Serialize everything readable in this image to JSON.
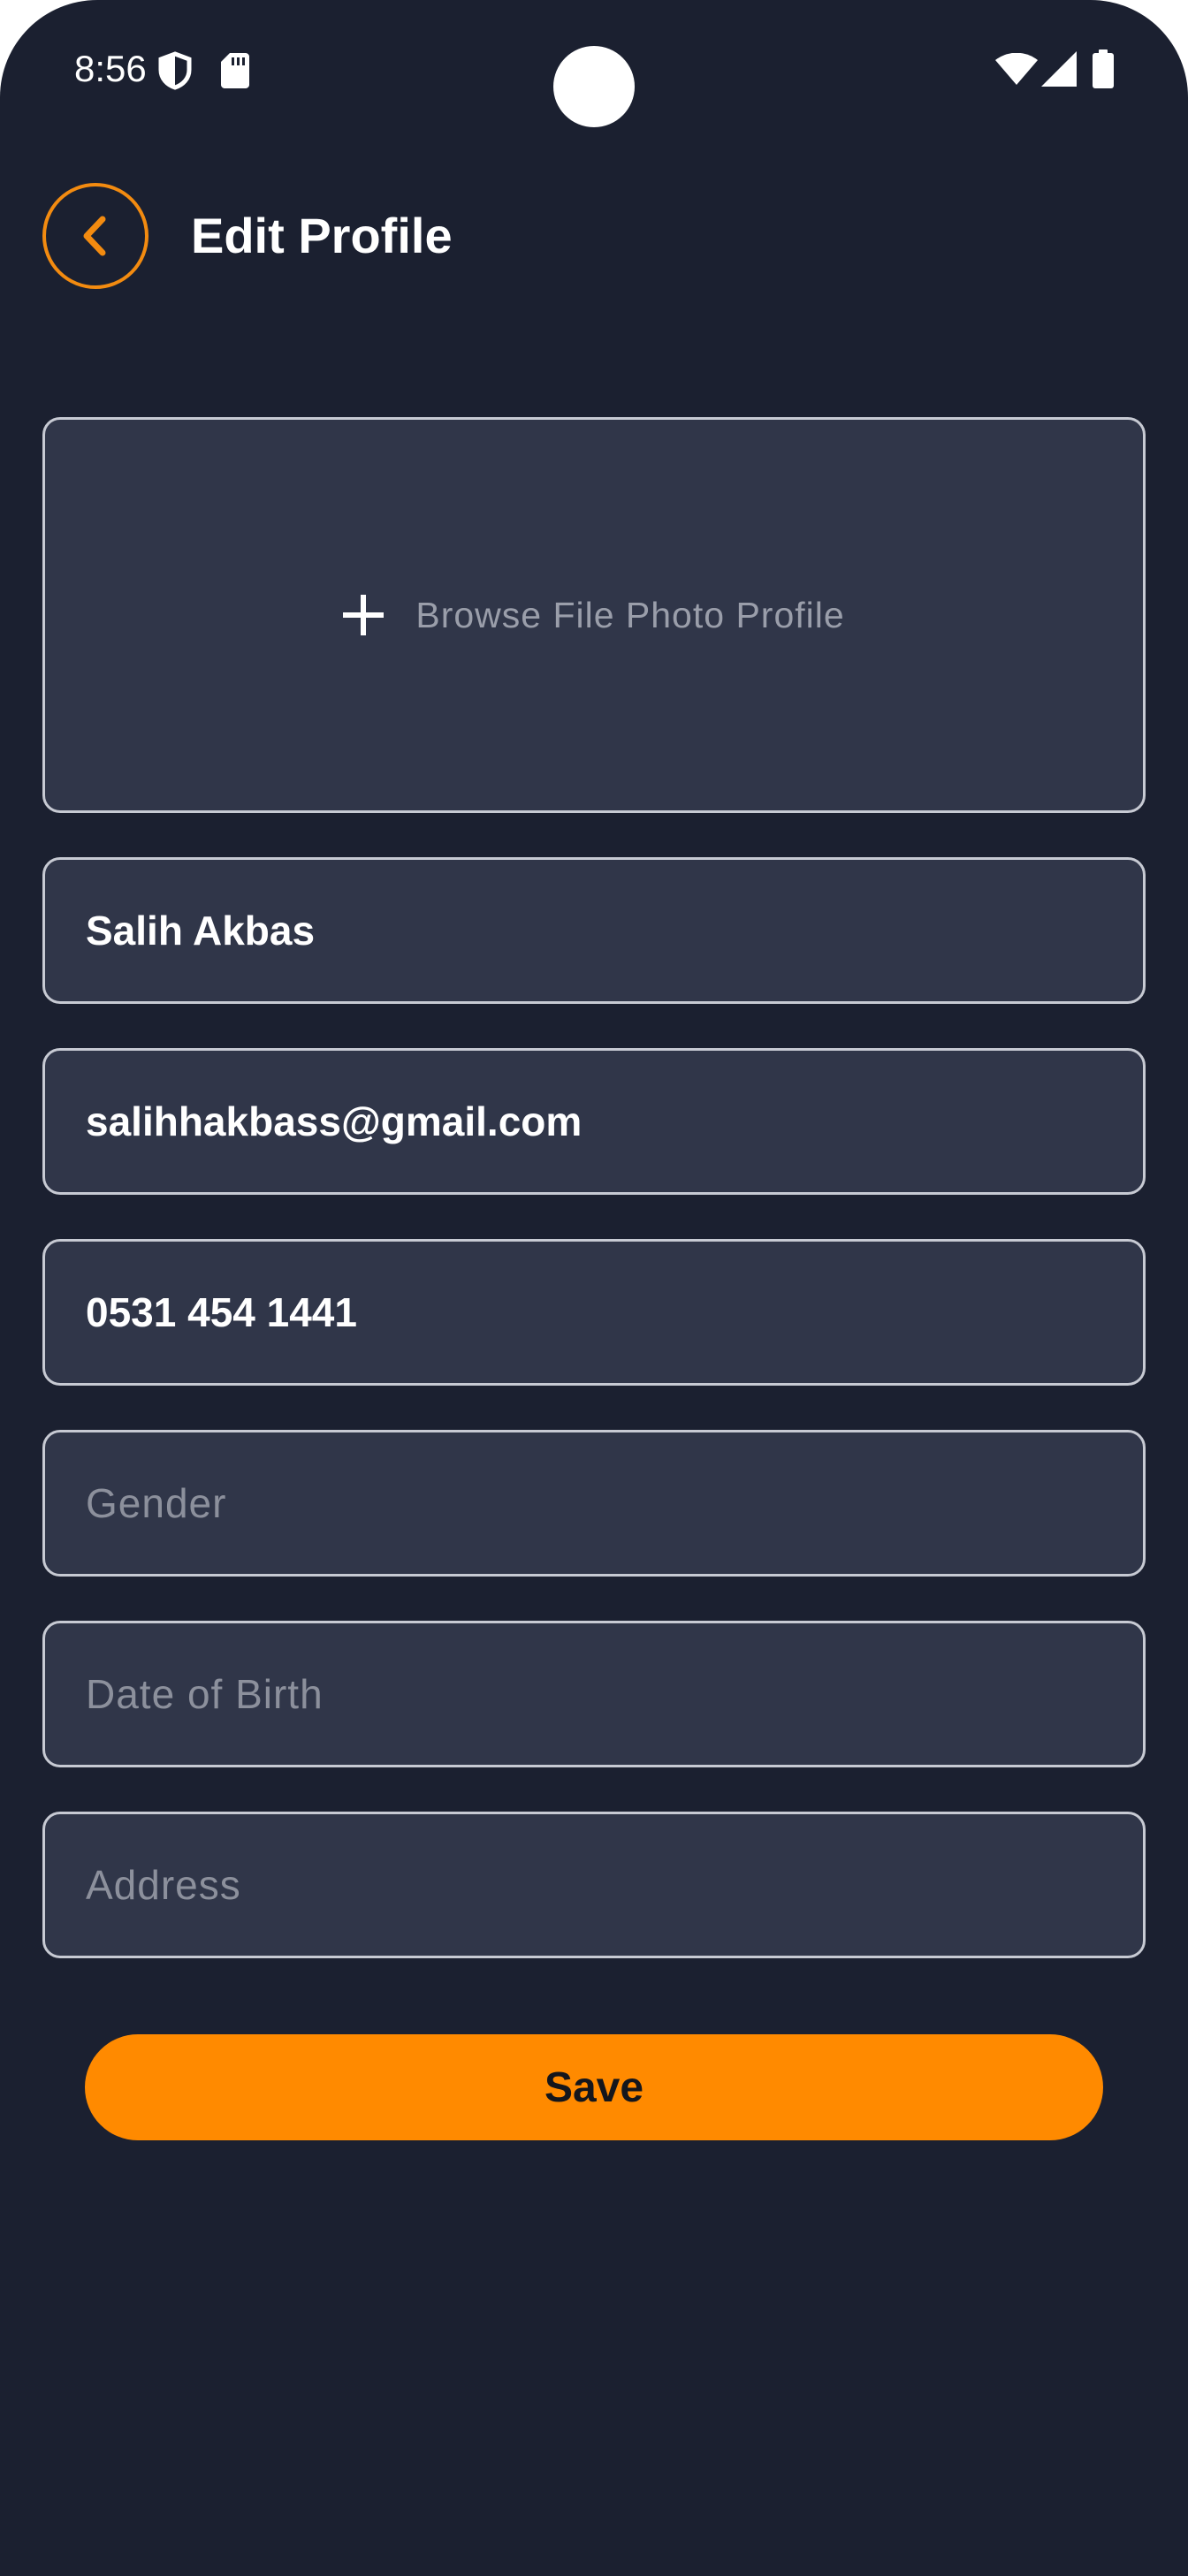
{
  "status_bar": {
    "time": "8:56",
    "icons": [
      "shield-icon",
      "sd-card-icon",
      "wifi-icon",
      "signal-icon",
      "battery-icon"
    ]
  },
  "header": {
    "back_icon": "chevron-left-icon",
    "title": "Edit Profile"
  },
  "photo_upload": {
    "icon": "plus-icon",
    "label": "Browse File Photo Profile"
  },
  "form": {
    "name": {
      "value": "Salih Akbas",
      "placeholder": ""
    },
    "email": {
      "value": "salihhakbass@gmail.com",
      "placeholder": ""
    },
    "phone": {
      "value": "0531 454 1441",
      "placeholder": ""
    },
    "gender": {
      "value": "",
      "placeholder": "Gender"
    },
    "date_of_birth": {
      "value": "",
      "placeholder": "Date of Birth"
    },
    "address": {
      "value": "",
      "placeholder": "Address"
    }
  },
  "save_button": {
    "label": "Save"
  },
  "colors": {
    "background": "#1B2030",
    "field_background": "#303649",
    "field_border": "#C7CAD3",
    "accent": "#FF8A00",
    "back_button_border": "#F38B10",
    "placeholder_text": "#8C909C"
  }
}
